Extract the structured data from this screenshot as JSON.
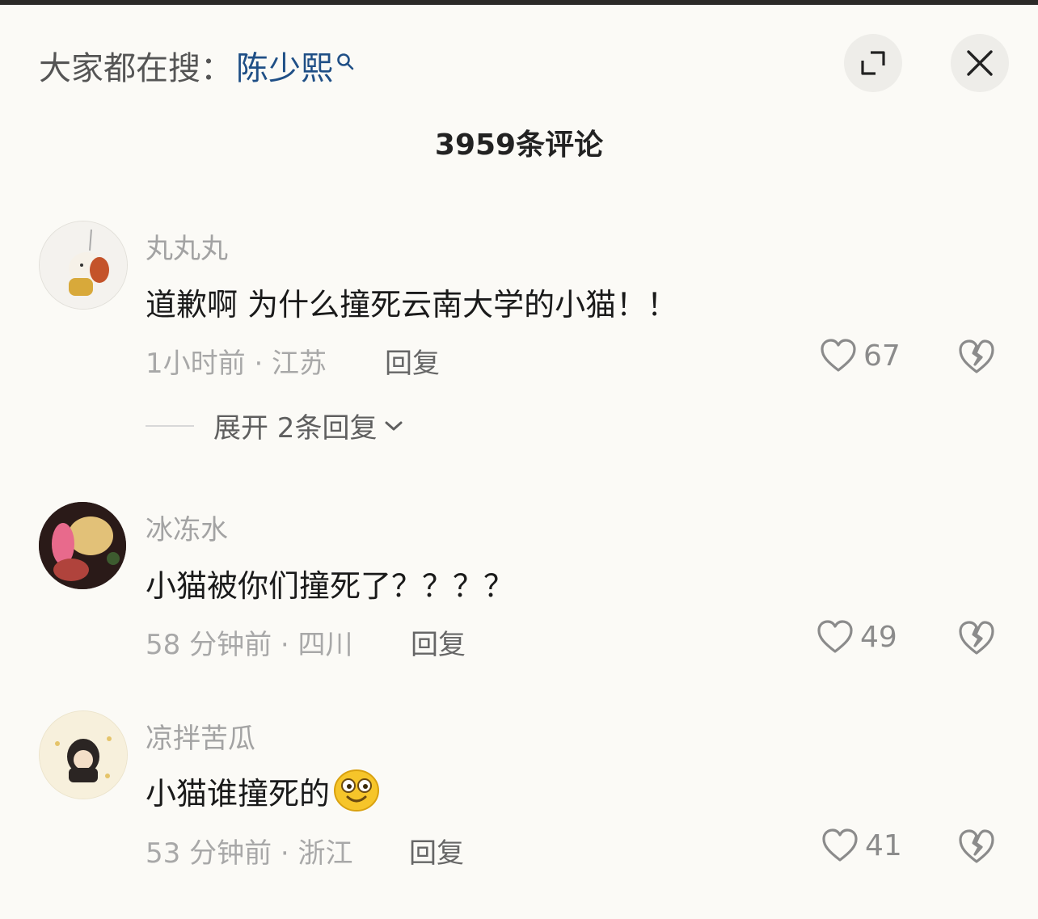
{
  "header": {
    "search_prefix": "大家都在搜：",
    "search_keyword": "陈少熙"
  },
  "comment_count": "3959条评论",
  "comments": [
    {
      "username": "丸丸丸",
      "text": "道歉啊 为什么撞死云南大学的小猫！！",
      "meta": "1小时前 · 江苏",
      "reply_label": "回复",
      "likes": "67",
      "expand_label": "展开 2条回复"
    },
    {
      "username": "冰冻水",
      "text": "小猫被你们撞死了？？？？",
      "meta": "58 分钟前 · 四川",
      "reply_label": "回复",
      "likes": "49"
    },
    {
      "username": "凉拌苦瓜",
      "text": "小猫谁撞死的",
      "emoji": "smiling-face-emoji",
      "meta": "53 分钟前 · 浙江",
      "reply_label": "回复",
      "likes": "41"
    }
  ],
  "colors": {
    "background": "#fbfaf6",
    "keyword": "#1f4f86",
    "username": "#a3a3a3",
    "meta": "#a8a8a8"
  }
}
